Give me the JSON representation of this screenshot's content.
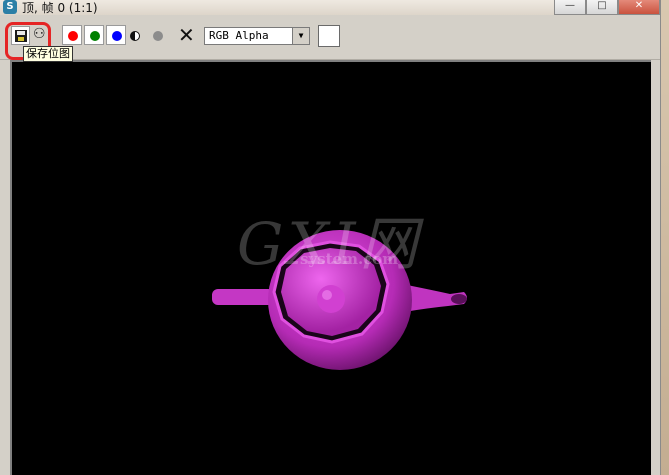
{
  "window": {
    "title": "顶, 帧 0 (1:1)",
    "app_icon_glyph": "S",
    "minimize_glyph": "—",
    "maximize_glyph": "□",
    "close_glyph": "✕"
  },
  "toolbar": {
    "save_icon": "save-icon",
    "copy_icon": "people-icon",
    "people_glyph": "⚇",
    "channels": [
      {
        "name": "red-channel",
        "color": "#ff0000"
      },
      {
        "name": "green-channel",
        "color": "#008000"
      },
      {
        "name": "blue-channel",
        "color": "#0000ff"
      }
    ],
    "clear_glyph": "✕",
    "channel_select": {
      "value": "RGB Alpha",
      "arrow": "▼"
    },
    "tooltip": "保存位图"
  },
  "render": {
    "object_color": "#cc33cc",
    "watermark_big": "GXI网",
    "watermark_small": "system.com"
  }
}
